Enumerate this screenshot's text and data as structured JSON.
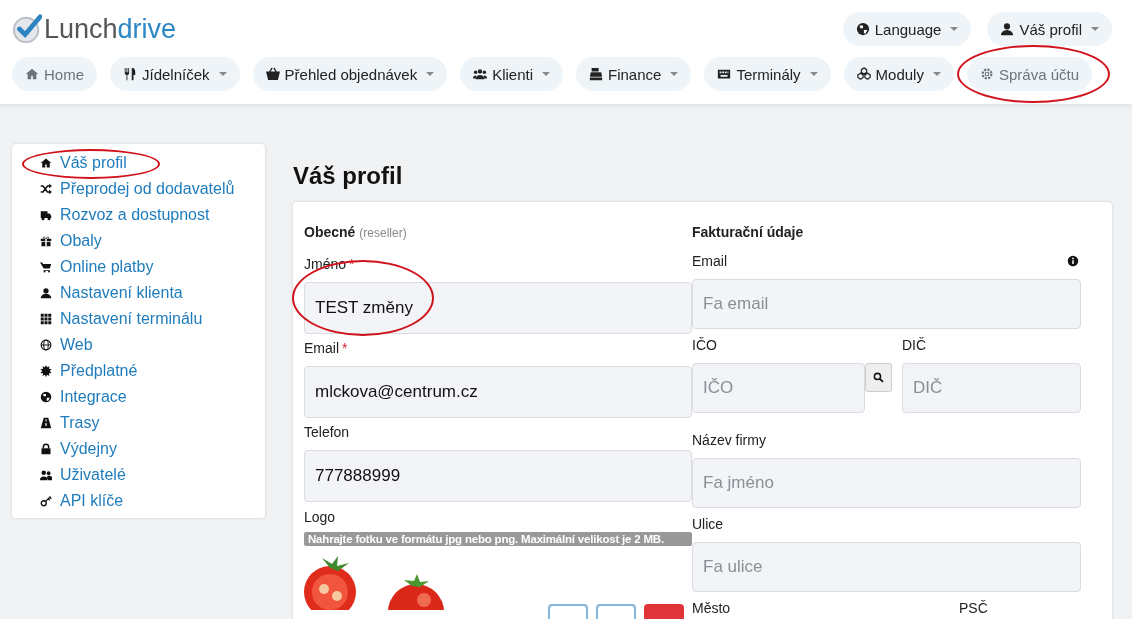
{
  "header": {
    "logo": {
      "part1": "Lunch",
      "part2": "drive"
    },
    "top_menu": [
      {
        "label": "Language",
        "has_menu": true
      },
      {
        "label": "Váš profil",
        "has_menu": true
      }
    ],
    "nav": [
      {
        "label": "Home",
        "has_menu": false,
        "muted": true
      },
      {
        "label": "Jídelníček",
        "has_menu": true,
        "muted": false
      },
      {
        "label": "Přehled objednávek",
        "has_menu": true,
        "muted": false
      },
      {
        "label": "Klienti",
        "has_menu": true,
        "muted": false
      },
      {
        "label": "Finance",
        "has_menu": true,
        "muted": false
      },
      {
        "label": "Terminály",
        "has_menu": true,
        "muted": false
      },
      {
        "label": "Moduly",
        "has_menu": true,
        "muted": false
      },
      {
        "label": "Správa účtu",
        "has_menu": false,
        "muted": true,
        "circled": true
      }
    ]
  },
  "sidebar": {
    "items": [
      {
        "label": "Váš profil",
        "circled": true
      },
      {
        "label": "Přeprodej od dodavatelů"
      },
      {
        "label": "Rozvoz a dostupnost"
      },
      {
        "label": "Obaly"
      },
      {
        "label": "Online platby"
      },
      {
        "label": "Nastavení klienta"
      },
      {
        "label": "Nastavení terminálu"
      },
      {
        "label": "Web"
      },
      {
        "label": "Předplatné"
      },
      {
        "label": "Integrace"
      },
      {
        "label": "Trasy"
      },
      {
        "label": "Výdejny"
      },
      {
        "label": "Uživatelé"
      },
      {
        "label": "API klíče"
      }
    ]
  },
  "page_title": "Váš profil",
  "general": {
    "title": "Obecné",
    "note": "(reseller)",
    "fields": [
      {
        "label": "Jméno",
        "required_mark": "*",
        "value": "TEST změny",
        "circled": true
      },
      {
        "label": "Email",
        "required_mark": "*",
        "value": "mlckova@centrum.cz"
      },
      {
        "label": "Telefon",
        "value": "777888999"
      }
    ],
    "logo_label": "Logo",
    "logo_hint": "Nahrajte fotku ve formátu jpg nebo png. Maximální velikost je 2 MB."
  },
  "billing": {
    "title": "Fakturační údaje",
    "rows": [
      [
        {
          "kind": "field",
          "label": "Email",
          "placeholder": "Fa email",
          "info": true
        }
      ],
      [
        {
          "kind": "search",
          "label": "IČO",
          "placeholder": "IČO"
        },
        {
          "kind": "field",
          "label": "DIČ",
          "placeholder": "DIČ"
        }
      ],
      [
        {
          "kind": "field",
          "label": "Název firmy",
          "placeholder": "Fa jméno"
        }
      ],
      [
        {
          "kind": "field",
          "label": "Ulice",
          "placeholder": "Fa ulice"
        }
      ],
      [
        {
          "kind": "label",
          "label": "Město"
        },
        {
          "kind": "label",
          "label": "PSČ"
        }
      ]
    ]
  }
}
